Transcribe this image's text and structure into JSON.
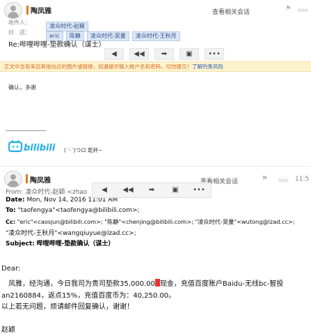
{
  "email_top": {
    "sender": "陶凤雅",
    "related_link": "查看相关会话",
    "to_label": "收件人：",
    "to": [
      "凌众时代-赵颖"
    ],
    "cc_label": "抄　送：",
    "cc": [
      "eric",
      "陈静",
      "凌众时代-吴量",
      "凌众时代-王秋月"
    ],
    "subject": "Re:哔哩哔哩-垫款确认（谋士）",
    "toolbar": [
      "reply",
      "reply-all",
      "forward",
      "archive",
      "more"
    ],
    "warning": "正文中含有来自其他站点的图片或链接，如遇提示输入帐户名和密码，切勿提交！",
    "warning_link": "了解钓鱼风险",
    "body": "确认，多谢",
    "signature_face": "( ‵- ‵)つロ 乾杯~",
    "logo_text": "bilibili"
  },
  "email_bottom": {
    "sender": "陶凤雅",
    "related_link": "查看相关会话",
    "status_dots": "ooo",
    "time_partial": "11:5",
    "header": {
      "from_partial": "From:   凌众时代-赵颖 <zhao",
      "date_label": "Date:",
      "date_value": "Mon, Nov 14, 2016 11:01 AM",
      "to_label": "To:",
      "to_value": "\"taofengya\"<taofengya@bilibili.com>;",
      "cc_label": "Cc:",
      "cc_value_1": "\"eric\"<caosjun@bilibili.com>; \"陈静\"<chenjing@bilibili.com>; \"凌众时代-吴量\"<wutong@lzad.cc>;",
      "cc_value_2": "\"凌众时代-王秋月\"<wangqiuyue@lzad.cc>;",
      "subject_label": "Subject:",
      "subject_value": "哔哩哔哩-垫款确认（谋士）"
    },
    "body": {
      "greeting": "Dear:",
      "line1_a": "　风雅，经沟通，今日我司为贵司垫款35,000.00",
      "line1_b": "现金，充值百度账户Baidu-无线bc-智投",
      "line2": "an2160884，返点15%，充值百度币为：40,250.00。",
      "line3": "以上若无问题，烦请邮件回复确认，谢谢！",
      "sign": "赵颖"
    }
  },
  "colors": {
    "accent_orange": "#e07a1f",
    "chip_bg": "#dbe6f5",
    "warning_bg": "#fdf3cf",
    "warning_text": "#d96b1e",
    "link_blue": "#2a5cab",
    "bilibili_blue": "#23ade5",
    "redaction": "#ee3333"
  }
}
